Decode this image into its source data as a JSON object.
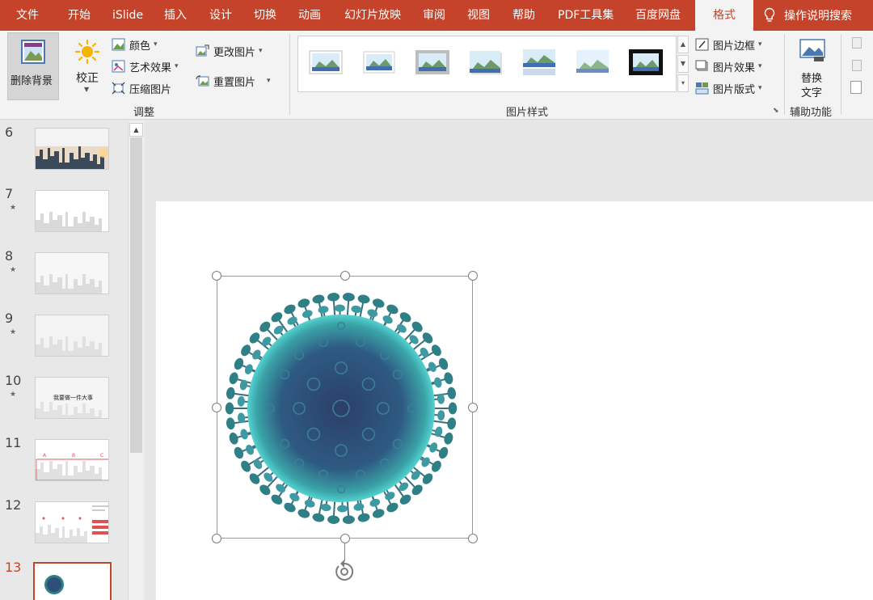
{
  "menu": {
    "tabs": [
      "文件",
      "开始",
      "iSlide",
      "插入",
      "设计",
      "切换",
      "动画",
      "幻灯片放映",
      "审阅",
      "视图",
      "帮助",
      "PDF工具集",
      "百度网盘",
      "格式"
    ],
    "active_tab": "格式",
    "search_label": "操作说明搜索"
  },
  "ribbon": {
    "adjust": {
      "remove_bg": "删除背景",
      "correct": "校正",
      "color": "颜色",
      "artistic": "艺术效果",
      "compress": "压缩图片",
      "change_pic": "更改图片",
      "reset_pic": "重置图片",
      "label": "调整"
    },
    "styles": {
      "label": "图片样式",
      "border": "图片边框",
      "effects": "图片效果",
      "layout": "图片版式"
    },
    "accessibility": {
      "alt_text_line1": "替换",
      "alt_text_line2": "文字",
      "label": "辅助功能"
    }
  },
  "slides": {
    "numbers": [
      "6",
      "7",
      "8",
      "9",
      "10",
      "11",
      "12",
      "13"
    ],
    "current": "13",
    "thumb10_text": "我要做一件大事",
    "thumb11_labels": [
      "A",
      "B",
      "C"
    ]
  },
  "colors": {
    "accent": "#c4432a",
    "virus_spike": "#2f7f86",
    "virus_body": "#2f4f7a"
  }
}
